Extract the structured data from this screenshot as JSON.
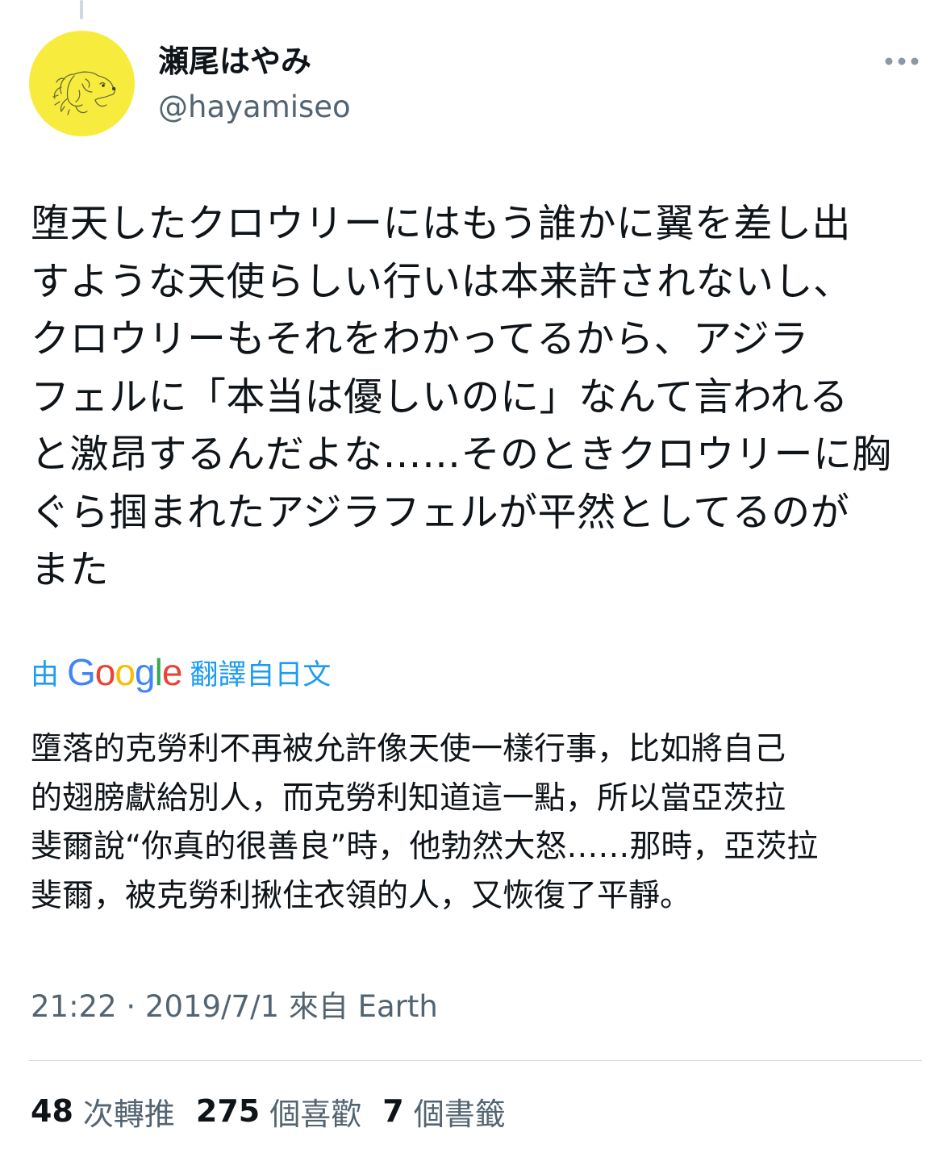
{
  "tweet": {
    "author": {
      "display_name": "瀬尾はやみ",
      "handle": "@hayamiseo",
      "avatar_bg": "#f7ec3d"
    },
    "more_icon": "more-horizontal-icon",
    "text_lines": [
      "堕天したクロウリーにはもう誰かに翼を差し出",
      "すような天使らしい行いは本来許されないし、",
      "クロウリーもそれをわかってるから、アジラ",
      "フェルに「本当は優しいのに」なんて言われる",
      "と激昂するんだよな……そのときクロウリーに胸",
      "ぐら掴まれたアジラフェルが平然としてるのが",
      "また"
    ],
    "translation": {
      "prefix": "由",
      "provider": "Google",
      "suffix": "翻譯自日文",
      "accent": "#1d9bf0",
      "lines": [
        "墮落的克勞利不再被允許像天使一樣行事，比如將自己",
        "的翅膀獻給別人，而克勞利知道這一點，所以當亞茨拉",
        "斐爾說“你真的很善良”時，他勃然大怒……那時，亞茨拉",
        "斐爾，被克勞利揪住衣領的人，又恢復了平靜。"
      ]
    },
    "timestamp": "21:22 · 2019/7/1 來自 Earth",
    "stats": {
      "retweets_count": "48",
      "retweets_label": "次轉推",
      "likes_count": "275",
      "likes_label": "個喜歡",
      "bookmarks_count": "7",
      "bookmarks_label": "個書籤"
    }
  }
}
